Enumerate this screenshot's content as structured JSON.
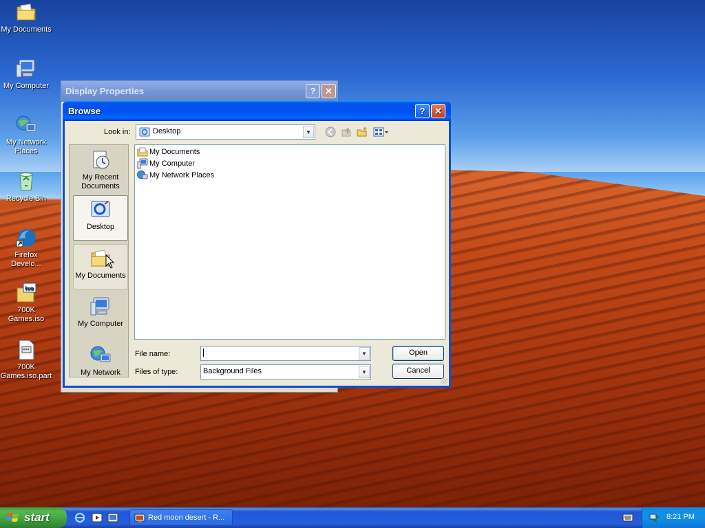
{
  "desktop": {
    "icons": [
      {
        "label": "My Documents"
      },
      {
        "label": "My Computer"
      },
      {
        "label": "My Network Places"
      },
      {
        "label": "Recycle Bin"
      },
      {
        "label": "Firefox Develo..."
      },
      {
        "label": "700K Games.iso"
      },
      {
        "label": "700K Games.iso.part"
      }
    ]
  },
  "display_properties": {
    "title": "Display Properties",
    "help_label": "?",
    "close_label": "✕"
  },
  "browse": {
    "title": "Browse",
    "help_label": "?",
    "close_label": "✕",
    "look_in_label": "Look in:",
    "look_in_value": "Desktop",
    "places": [
      {
        "label": "My Recent Documents"
      },
      {
        "label": "Desktop"
      },
      {
        "label": "My Documents"
      },
      {
        "label": "My Computer"
      },
      {
        "label": "My Network"
      }
    ],
    "files": [
      {
        "label": "My Documents"
      },
      {
        "label": "My Computer"
      },
      {
        "label": "My Network Places"
      }
    ],
    "file_name_label": "File name:",
    "file_name_value": "",
    "files_of_type_label": "Files of type:",
    "files_of_type_value": "Background Files",
    "open_label": "Open",
    "cancel_label": "Cancel"
  },
  "taskbar": {
    "start_label": "start",
    "task_label": "Red moon desert - R...",
    "clock": "8:21 PM"
  },
  "colors": {
    "title_bar": "#0053ee",
    "taskbar": "#245edb",
    "start_button": "#3a9a3a",
    "dialog_bg": "#ece9d8"
  }
}
